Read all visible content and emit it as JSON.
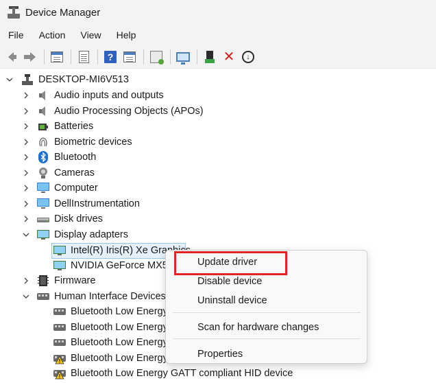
{
  "window": {
    "title": "Device Manager"
  },
  "menubar": {
    "items": [
      "File",
      "Action",
      "View",
      "Help"
    ]
  },
  "toolbar": {
    "buttons": [
      "back-arrow-icon",
      "forward-arrow-icon",
      "properties-window-icon",
      "document-icon",
      "help-icon",
      "window-list-icon",
      "scan-hardware-icon",
      "monitor-icon",
      "update-driver-icon",
      "uninstall-x-icon",
      "download-circle-icon"
    ]
  },
  "tree": {
    "root": "DESKTOP-MI6V513",
    "categories": [
      {
        "label": "Audio inputs and outputs",
        "icon": "speaker-icon",
        "expanded": false
      },
      {
        "label": "Audio Processing Objects (APOs)",
        "icon": "speaker-icon",
        "expanded": false
      },
      {
        "label": "Batteries",
        "icon": "battery-icon",
        "expanded": false
      },
      {
        "label": "Biometric devices",
        "icon": "fingerprint-icon",
        "expanded": false
      },
      {
        "label": "Bluetooth",
        "icon": "bluetooth-icon",
        "expanded": false
      },
      {
        "label": "Cameras",
        "icon": "camera-icon",
        "expanded": false
      },
      {
        "label": "Computer",
        "icon": "computer-icon",
        "expanded": false
      },
      {
        "label": "DellInstrumentation",
        "icon": "computer-icon",
        "expanded": false
      },
      {
        "label": "Disk drives",
        "icon": "disk-drive-icon",
        "expanded": false
      },
      {
        "label": "Display adapters",
        "icon": "display-adapter-icon",
        "expanded": true
      },
      {
        "label": "Firmware",
        "icon": "firmware-chip-icon",
        "expanded": false
      },
      {
        "label": "Human Interface Devices",
        "icon": "hid-icon",
        "expanded": true
      }
    ],
    "display_children": [
      "Intel(R) Iris(R) Xe Graphics",
      "NVIDIA GeForce MX5"
    ],
    "hid_children": [
      {
        "label": "Bluetooth Low Energy",
        "warning": false
      },
      {
        "label": "Bluetooth Low Energy",
        "warning": false
      },
      {
        "label": "Bluetooth Low Energy",
        "warning": false
      },
      {
        "label": "Bluetooth Low Energy",
        "warning": true
      },
      {
        "label": "Bluetooth Low Energy GATT compliant HID device",
        "warning": true
      }
    ]
  },
  "context_menu": {
    "update_driver": "Update driver",
    "disable_device": "Disable device",
    "uninstall_device": "Uninstall device",
    "scan_hardware": "Scan for hardware changes",
    "properties": "Properties"
  },
  "colors": {
    "highlight": "#e12424",
    "selection": "#e5f0fb",
    "accent": "#2f5fbf"
  }
}
